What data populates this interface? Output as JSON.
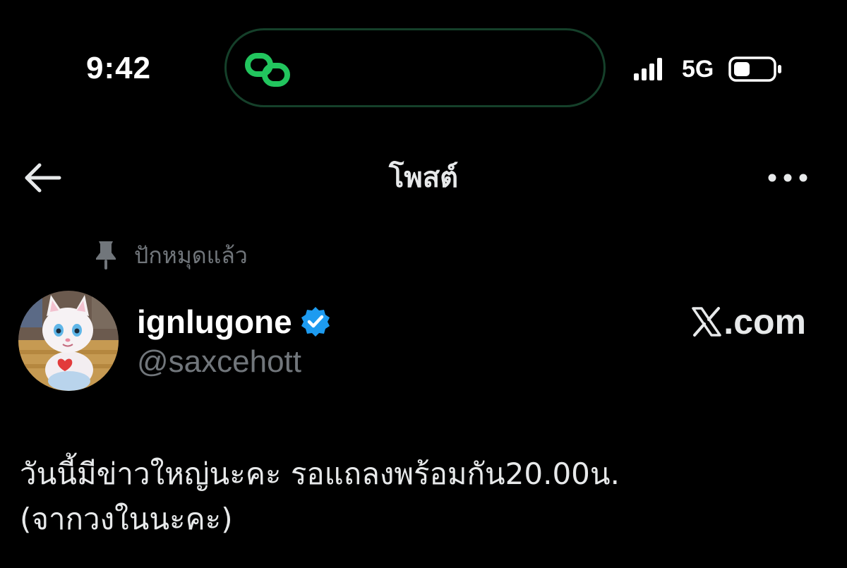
{
  "status_bar": {
    "time": "9:42",
    "network": "5G",
    "island_icon": "link-chain-icon",
    "signal_icon": "signal-bars-icon",
    "battery_icon": "battery-low-icon",
    "island_accent": "#22c55e"
  },
  "header": {
    "title": "โพสต์",
    "back_icon": "arrow-left-icon",
    "more_icon": "more-horizontal-icon"
  },
  "pinned": {
    "label": "ปักหมุดแล้ว",
    "icon": "pin-icon"
  },
  "author": {
    "display_name": "ignlugone",
    "handle": "@saxcehott",
    "verified": true,
    "verified_color": "#1d9bf0",
    "avatar_icon": "avatar-cat-icon"
  },
  "source": {
    "label": ".com",
    "logo": "x-logo-icon"
  },
  "post": {
    "text_line1": "วันนี้มีข่าวใหญ่นะคะ รอแถลงพร้อมกัน20.00น.",
    "text_line2": "(จากวงในนะคะ)"
  },
  "colors": {
    "background": "#000000",
    "primary_text": "#e7e9ea",
    "secondary_text": "#71767b"
  }
}
